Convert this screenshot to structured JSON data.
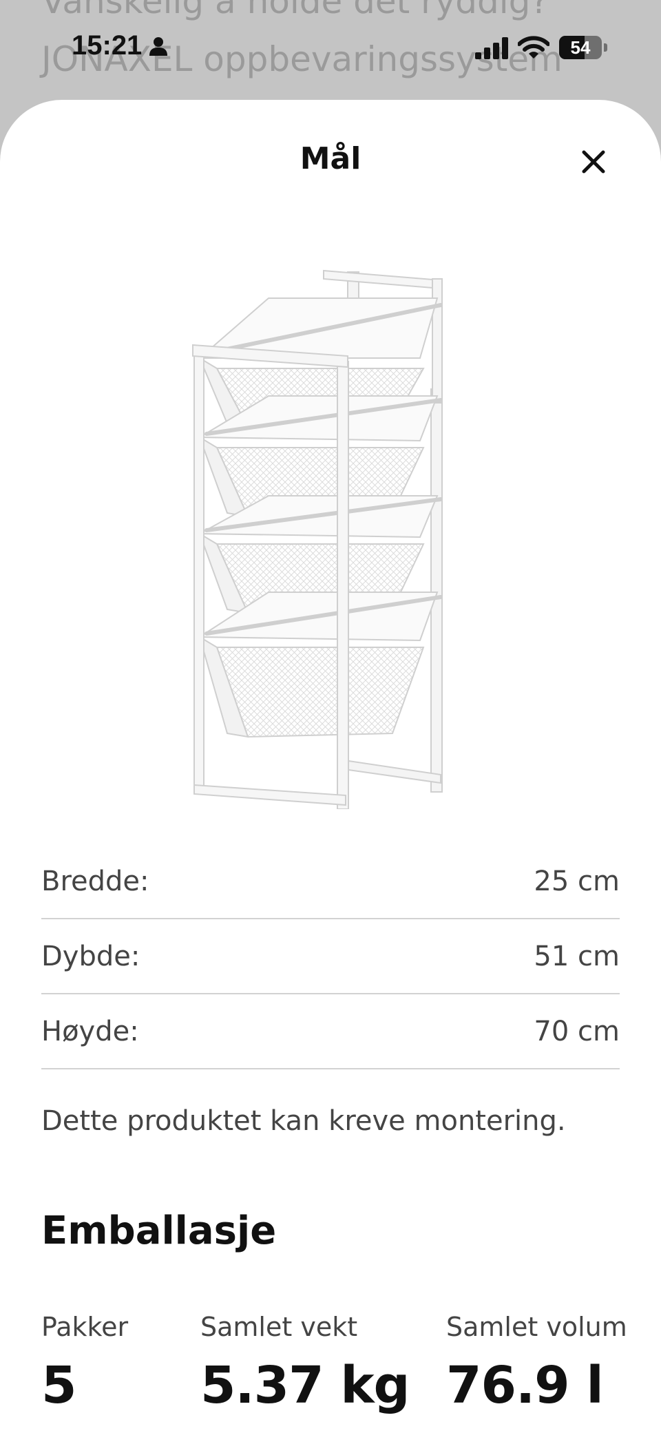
{
  "background_text": "Vanskelig å holde det ryddig? JONAXEL oppbevaringssystem gjør at du kan bruke plassen du har",
  "status_bar": {
    "time": "15:21",
    "battery": "54"
  },
  "sheet": {
    "title": "Mål",
    "close_icon": "close-icon",
    "product_image": "JONAXEL white wire basket frame with four mesh drawers"
  },
  "dimensions": [
    {
      "label": "Bredde:",
      "value": "25 cm"
    },
    {
      "label": "Dybde:",
      "value": "51 cm"
    },
    {
      "label": "Høyde:",
      "value": "70 cm"
    }
  ],
  "assembly_note": "Dette produktet kan kreve montering.",
  "packaging": {
    "title": "Emballasje",
    "items": [
      {
        "label": "Pakker",
        "value": "5"
      },
      {
        "label": "Samlet vekt",
        "value": "5.37 kg"
      },
      {
        "label": "Samlet volum",
        "value": "76.9 l"
      }
    ]
  },
  "colors": {
    "overlay": "#c4c4c4",
    "sheet": "#ffffff",
    "divider": "#d2d2d2",
    "text": "#111111",
    "secondary_text": "#444444"
  }
}
